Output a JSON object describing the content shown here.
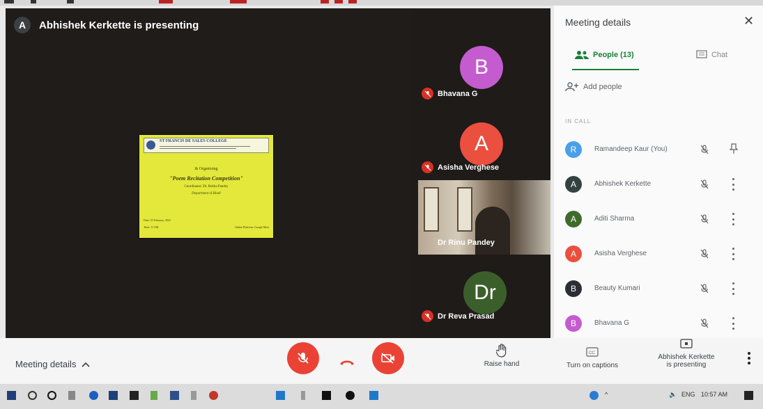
{
  "presenting_banner": {
    "avatar_letter": "A",
    "text": "Abhishek Kerkette is presenting"
  },
  "slide": {
    "college": "ST FRANCIS DE SALES COLLEGE",
    "organising": "& Organising",
    "title": "\"Poem Recitation Competition\"",
    "coordinator": "Coordinator: Dr. Rekha Pandey",
    "department": "Department of Hindi",
    "date": "Date: 25 February, 2022",
    "time": "Time: 11 AM",
    "footer": "Online Platform: Google Meet"
  },
  "tiles": [
    {
      "initials": "B",
      "name": "Bhavana G",
      "color": "#c45ccf"
    },
    {
      "initials": "A",
      "name": "Asisha Verghese",
      "color": "#ea4f3f"
    },
    {
      "initials": "",
      "name": "Dr Rinu Pandey",
      "color": ""
    },
    {
      "initials": "Dr",
      "name": "Dr Reva Prasad",
      "color": "#3b5f2a"
    }
  ],
  "panel": {
    "title": "Meeting details",
    "tab_people": "People (13)",
    "tab_chat": "Chat",
    "add_people": "Add people",
    "in_call_label": "IN CALL",
    "participants": [
      {
        "initial": "R",
        "name": "Ramandeep Kaur (You)",
        "color": "#4a9fe8"
      },
      {
        "initial": "A",
        "name": "Abhishek Kerkette",
        "color": "#33423f"
      },
      {
        "initial": "A",
        "name": "Aditi Sharma",
        "color": "#3f6b2a"
      },
      {
        "initial": "A",
        "name": "Asisha Verghese",
        "color": "#ea4f3f"
      },
      {
        "initial": "B",
        "name": "Beauty Kumari",
        "color": "#2b2f33"
      },
      {
        "initial": "B",
        "name": "Bhavana G",
        "color": "#c45ccf"
      }
    ]
  },
  "bottom": {
    "meeting_details": "Meeting details",
    "raise_hand": "Raise hand",
    "captions": "Turn on captions",
    "presenting_line1": "Abhishek Kerkette",
    "presenting_line2": "is presenting"
  },
  "taskbar": {
    "lang": "ENG",
    "time": "10:57 AM"
  },
  "colors": {
    "accent_green": "#188038",
    "danger_red": "#ea4335"
  }
}
